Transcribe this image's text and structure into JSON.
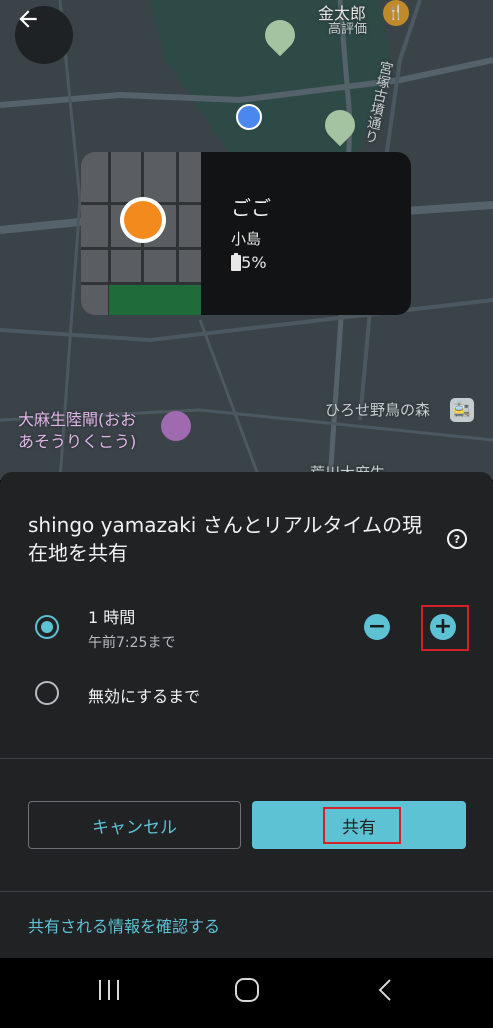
{
  "map": {
    "labels": {
      "kintaro": "金太郎",
      "kintaro_sub": "高評価",
      "road": "宮塚古墳通り",
      "place": "大麻生陸閘(おお",
      "place2": "あそうりくこう)",
      "park": "ひろせ野鳥の森",
      "partial": "荒川大麻生"
    }
  },
  "card": {
    "name": "ごご",
    "location": "小島",
    "battery": "95%"
  },
  "sheet": {
    "title": "shingo yamazaki さんとリアルタイムの現在地を共有",
    "help_symbol": "?",
    "option1": {
      "label": "1 時間",
      "sub": "午前7:25まで"
    },
    "option2": {
      "label": "無効にするまで"
    },
    "minus_symbol": "−",
    "plus_symbol": "+",
    "cancel_label": "キャンセル",
    "share_label": "共有",
    "info_link": "共有される情報を確認する"
  },
  "colors": {
    "accent": "#5dc3d4",
    "highlight": "#d61f26",
    "sheet_bg": "#212224",
    "map_bg": "#3a4348"
  },
  "icons": [
    "back-arrow-icon",
    "help-icon",
    "battery-icon",
    "minus-icon",
    "plus-icon",
    "recent-apps-icon",
    "home-icon",
    "nav-back-icon",
    "restaurant-icon",
    "train-station-icon",
    "place-icon"
  ]
}
